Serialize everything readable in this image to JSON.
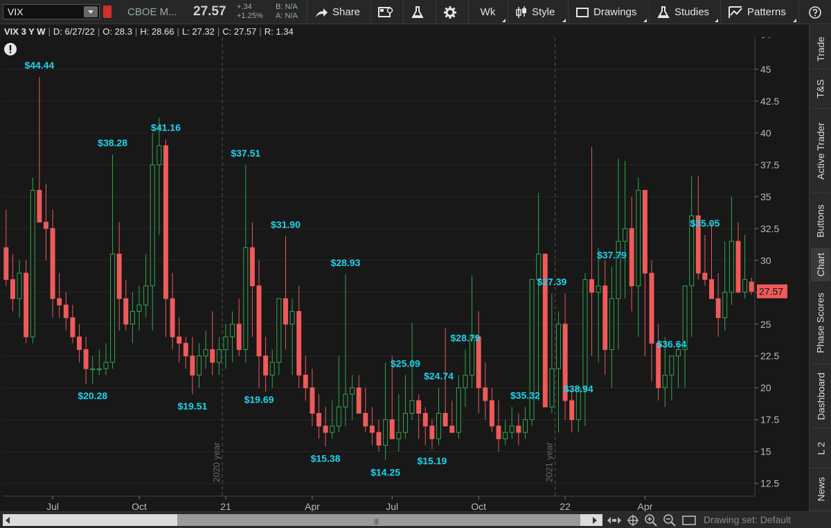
{
  "toolbar": {
    "symbol": "VIX",
    "description": "CBOE M...",
    "last": "27.57",
    "net_change": "+.34",
    "pct_change": "+1.25%",
    "bid": "B: N/A",
    "ask": "A: N/A",
    "share_label": "Share",
    "period_label": "Wk",
    "style_label": "Style",
    "drawings_label": "Drawings",
    "studies_label": "Studies",
    "patterns_label": "Patterns"
  },
  "info": {
    "title": "VIX 3 Y W",
    "date": "D: 6/27/22",
    "open": "O: 28.3",
    "high": "H: 28.66",
    "low": "L: 27.32",
    "close": "C: 27.57",
    "range": "R: 1.34"
  },
  "sidebar": {
    "tabs": [
      "Trade",
      "T&S",
      "Active Trader",
      "Buttons",
      "Chart",
      "Phase Scores",
      "Dashboard",
      "L 2",
      "News"
    ],
    "active": "Chart"
  },
  "bottom": {
    "drawing_set": "Drawing set: Default"
  },
  "colors": {
    "up": "#2fa84f",
    "down": "#f05a5a",
    "label": "#19d6f0",
    "price_tag": "#f05a5a"
  },
  "chart_data": {
    "type": "candlestick",
    "ylim": [
      11.5,
      47.5
    ],
    "yticks": [
      "12.5",
      "15",
      "17.5",
      "20",
      "22.5",
      "25",
      "27.5",
      "30",
      "32.5",
      "35",
      "37.5",
      "40",
      "42.5",
      "45"
    ],
    "xticks": [
      {
        "label": "Jul",
        "i": 7
      },
      {
        "label": "Oct",
        "i": 20
      },
      {
        "label": "21",
        "i": 33
      },
      {
        "label": "Apr",
        "i": 46
      },
      {
        "label": "Jul",
        "i": 58
      },
      {
        "label": "Oct",
        "i": 71
      },
      {
        "label": "22",
        "i": 84
      },
      {
        "label": "Apr",
        "i": 96
      }
    ],
    "year_markers": [
      {
        "label": "2020 year",
        "i": 32.5
      },
      {
        "label": "2021 year",
        "i": 82.5
      }
    ],
    "current_price": "27.57",
    "annotations": [
      {
        "text": "$44.44",
        "i": 5,
        "pos": "above"
      },
      {
        "text": "$20.28",
        "i": 13,
        "pos": "below"
      },
      {
        "text": "$38.28",
        "i": 16,
        "pos": "above"
      },
      {
        "text": "$41.16",
        "i": 24,
        "pos": "above"
      },
      {
        "text": "$19.51",
        "i": 28,
        "pos": "below"
      },
      {
        "text": "$37.51",
        "i": 36,
        "pos": "above"
      },
      {
        "text": "$19.69",
        "i": 38,
        "pos": "below"
      },
      {
        "text": "$31.90",
        "i": 42,
        "pos": "above"
      },
      {
        "text": "$15.38",
        "i": 48,
        "pos": "below"
      },
      {
        "text": "$28.93",
        "i": 51,
        "pos": "above"
      },
      {
        "text": "$14.25",
        "i": 57,
        "pos": "below"
      },
      {
        "text": "$25.09",
        "i": 60,
        "pos": "above"
      },
      {
        "text": "$15.19",
        "i": 64,
        "pos": "below"
      },
      {
        "text": "$24.74",
        "i": 65,
        "pos": "above"
      },
      {
        "text": "$28.79",
        "i": 69,
        "pos": "above"
      },
      {
        "text": "$35.32",
        "i": 78,
        "pos": "above"
      },
      {
        "text": "$27.39",
        "i": 82,
        "pos": "above"
      },
      {
        "text": "$38.94",
        "i": 86,
        "pos": "above"
      },
      {
        "text": "$37.79",
        "i": 91,
        "pos": "above"
      },
      {
        "text": "$36.64",
        "i": 100,
        "pos": "above"
      },
      {
        "text": "$35.05",
        "i": 105,
        "pos": "above"
      }
    ],
    "candles": [
      [
        31,
        34,
        28,
        28.5
      ],
      [
        28.5,
        30.5,
        26,
        27
      ],
      [
        27,
        30,
        25.5,
        29
      ],
      [
        29,
        30,
        23.5,
        24
      ],
      [
        24,
        36.5,
        23.5,
        35.5
      ],
      [
        35.5,
        44.4,
        34,
        33
      ],
      [
        33,
        36,
        30,
        32.5
      ],
      [
        32.5,
        34,
        25.5,
        27
      ],
      [
        27,
        29,
        25.5,
        26.5
      ],
      [
        26.5,
        27.5,
        24.5,
        25.5
      ],
      [
        25.5,
        26.5,
        23.5,
        24
      ],
      [
        24,
        25,
        22,
        23
      ],
      [
        23,
        24,
        20.3,
        21.5
      ],
      [
        21.5,
        22.5,
        20.3,
        21.5
      ],
      [
        21.5,
        23,
        21,
        21.5
      ],
      [
        21.5,
        23.5,
        21,
        22
      ],
      [
        22,
        38.3,
        21.5,
        30.5
      ],
      [
        30.5,
        33,
        24.5,
        27
      ],
      [
        27,
        28.5,
        24.5,
        25
      ],
      [
        25,
        27.5,
        23.5,
        26
      ],
      [
        26,
        28,
        24.5,
        26.5
      ],
      [
        26.5,
        30.5,
        25.5,
        28
      ],
      [
        28,
        40,
        24.5,
        37.5
      ],
      [
        37.5,
        41.2,
        32,
        39
      ],
      [
        39,
        39.5,
        24,
        27
      ],
      [
        27,
        29,
        23,
        24
      ],
      [
        24,
        25.5,
        22,
        23.5
      ],
      [
        23.5,
        24,
        21.5,
        22.5
      ],
      [
        22.5,
        24,
        19.5,
        21
      ],
      [
        21,
        23.5,
        20,
        22.5
      ],
      [
        22.5,
        24.5,
        21.5,
        23
      ],
      [
        23,
        26,
        21,
        22
      ],
      [
        22,
        24,
        21,
        23
      ],
      [
        23,
        25,
        21.5,
        24
      ],
      [
        24,
        26,
        22,
        25
      ],
      [
        25,
        27,
        22.5,
        23
      ],
      [
        23,
        37.5,
        22,
        31
      ],
      [
        31,
        33,
        24,
        28
      ],
      [
        28,
        30,
        20,
        22.5
      ],
      [
        22.5,
        24,
        19.7,
        21
      ],
      [
        21,
        23,
        20,
        22
      ],
      [
        22,
        26.5,
        21,
        27
      ],
      [
        27,
        31.9,
        23,
        25
      ],
      [
        25,
        27,
        21,
        26
      ],
      [
        26,
        28,
        20,
        21
      ],
      [
        21,
        22.5,
        19,
        20
      ],
      [
        20,
        21.5,
        17,
        18
      ],
      [
        18,
        19.5,
        16,
        17
      ],
      [
        17,
        18.5,
        15.4,
        16.5
      ],
      [
        16.5,
        19,
        16,
        17
      ],
      [
        17,
        22.5,
        16.5,
        18.5
      ],
      [
        18.5,
        28.9,
        17,
        19.5
      ],
      [
        19.5,
        21,
        17.5,
        20
      ],
      [
        20,
        21,
        18.5,
        18
      ],
      [
        18,
        20,
        16.5,
        17
      ],
      [
        17,
        18.5,
        15.5,
        16.5
      ],
      [
        16.5,
        17.5,
        15,
        15.5
      ],
      [
        15.5,
        22,
        14.3,
        17.5
      ],
      [
        17.5,
        22.5,
        16.5,
        16
      ],
      [
        16,
        19.5,
        15,
        16.5
      ],
      [
        16.5,
        21,
        16,
        18
      ],
      [
        18,
        25.1,
        17.5,
        19
      ],
      [
        19,
        19.5,
        16,
        18
      ],
      [
        18,
        18.5,
        15.5,
        17
      ],
      [
        17,
        17.5,
        15.2,
        16
      ],
      [
        16,
        20,
        15.5,
        18
      ],
      [
        18,
        24.7,
        17,
        17
      ],
      [
        17,
        19,
        16.5,
        16.5
      ],
      [
        16.5,
        21,
        16,
        20
      ],
      [
        20,
        23,
        18.5,
        21
      ],
      [
        21,
        28.8,
        20,
        24
      ],
      [
        24,
        26,
        18,
        20
      ],
      [
        20,
        22,
        17.5,
        19
      ],
      [
        19,
        20,
        16.5,
        17
      ],
      [
        17,
        19,
        15,
        16
      ],
      [
        16,
        17.5,
        15.5,
        16.5
      ],
      [
        16.5,
        18.5,
        16,
        17
      ],
      [
        17,
        18,
        15.5,
        16.5
      ],
      [
        16.5,
        18.5,
        16,
        17.5
      ],
      [
        17.5,
        21,
        17,
        28.5
      ],
      [
        28.5,
        35.3,
        19,
        30.5
      ],
      [
        30.5,
        30.5,
        25,
        18.5
      ],
      [
        18.5,
        27.4,
        18,
        21.5
      ],
      [
        21.5,
        26,
        16.5,
        25
      ],
      [
        25,
        27.4,
        17.5,
        19
      ],
      [
        19,
        20,
        16.5,
        17.5
      ],
      [
        17.5,
        19,
        16.5,
        20
      ],
      [
        20,
        29,
        17,
        28.5
      ],
      [
        28.5,
        38.9,
        22.5,
        27.5
      ],
      [
        27.5,
        31,
        22,
        28
      ],
      [
        28,
        30,
        21,
        23
      ],
      [
        23,
        29.5,
        20,
        27
      ],
      [
        27,
        38,
        23,
        31.5
      ],
      [
        31.5,
        37.8,
        27,
        32.5
      ],
      [
        32.5,
        35,
        26,
        28
      ],
      [
        28,
        36.5,
        24,
        35.5
      ],
      [
        35.5,
        35.5,
        22.5,
        29
      ],
      [
        29,
        30,
        20.5,
        23.5
      ],
      [
        23.5,
        25,
        19,
        20
      ],
      [
        20,
        24,
        18.5,
        21
      ],
      [
        21,
        22.5,
        19,
        22.5
      ],
      [
        22.5,
        23.5,
        20,
        23
      ],
      [
        23,
        25,
        20,
        28
      ],
      [
        28,
        36.6,
        24,
        33.5
      ],
      [
        33.5,
        36.6,
        28.5,
        29
      ],
      [
        29,
        32,
        28,
        28.5
      ],
      [
        28.5,
        33,
        27.5,
        27
      ],
      [
        27,
        29,
        24,
        25.5
      ],
      [
        25.5,
        31.5,
        24.5,
        27.5
      ],
      [
        27.5,
        35,
        26.5,
        31.5
      ],
      [
        31.5,
        33,
        27.5,
        27.5
      ],
      [
        27.5,
        32,
        27,
        28.5
      ],
      [
        28.3,
        28.66,
        27.32,
        27.57
      ]
    ]
  }
}
